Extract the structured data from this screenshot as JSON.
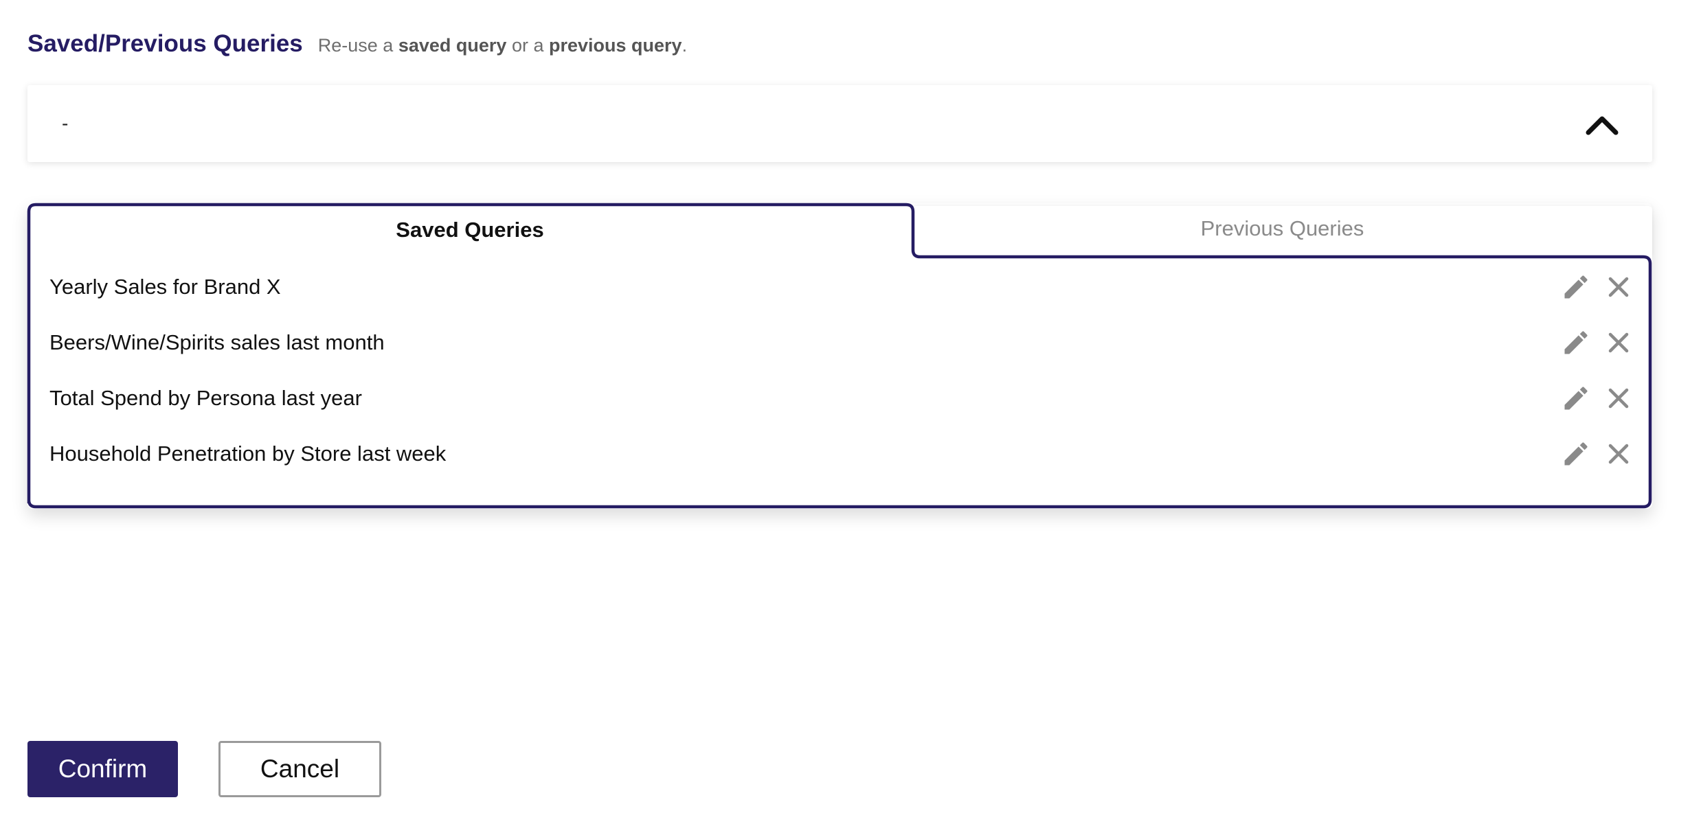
{
  "header": {
    "title": "Saved/Previous Queries",
    "desc_prefix": "Re-use a",
    "desc_saved": "saved query",
    "desc_middle": "or a",
    "desc_previous": "previous query",
    "desc_suffix": "."
  },
  "dropdown": {
    "value": "-",
    "icon": "chevron-up-icon",
    "expanded": true
  },
  "tabs": [
    {
      "label": "Saved Queries",
      "active": true
    },
    {
      "label": "Previous Queries",
      "active": false
    }
  ],
  "saved_queries": [
    {
      "label": "Yearly Sales for Brand X"
    },
    {
      "label": "Beers/Wine/Spirits sales last month"
    },
    {
      "label": "Total Spend by Persona last year"
    },
    {
      "label": "Household Penetration by Store last week"
    }
  ],
  "row_icons": {
    "edit": "pencil-icon",
    "delete": "close-icon"
  },
  "buttons": {
    "confirm": "Confirm",
    "cancel": "Cancel"
  },
  "colors": {
    "accent": "#2b2268",
    "title": "#251c63",
    "icon": "#8a8a8a",
    "inactive_tab_text": "#8a8a8a"
  }
}
